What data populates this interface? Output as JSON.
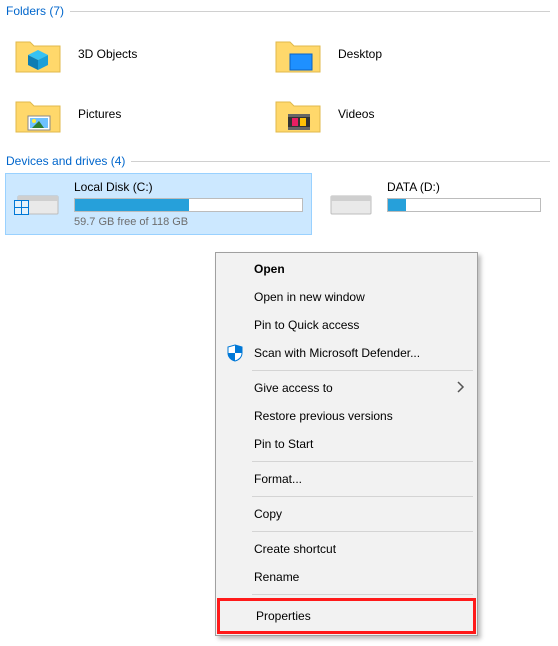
{
  "sections": {
    "folders": {
      "label": "Folders",
      "count": 7
    },
    "drives": {
      "label": "Devices and drives",
      "count": 4
    }
  },
  "folders": {
    "f0": "3D Objects",
    "f1": "Desktop",
    "f2": "Pictures",
    "f3": "Videos"
  },
  "drives": {
    "d0": {
      "name": "Local Disk (C:)",
      "free_text": "59.7 GB free of 118 GB",
      "used_pct": 50
    },
    "d1": {
      "name": "DATA (D:)",
      "free_text": "",
      "used_pct": 12
    }
  },
  "menu": {
    "open": "Open",
    "open_new": "Open in new window",
    "pin_qa": "Pin to Quick access",
    "defender": "Scan with Microsoft Defender...",
    "give_access": "Give access to",
    "restore": "Restore previous versions",
    "pin_start": "Pin to Start",
    "format": "Format...",
    "copy": "Copy",
    "shortcut": "Create shortcut",
    "rename": "Rename",
    "properties": "Properties"
  }
}
